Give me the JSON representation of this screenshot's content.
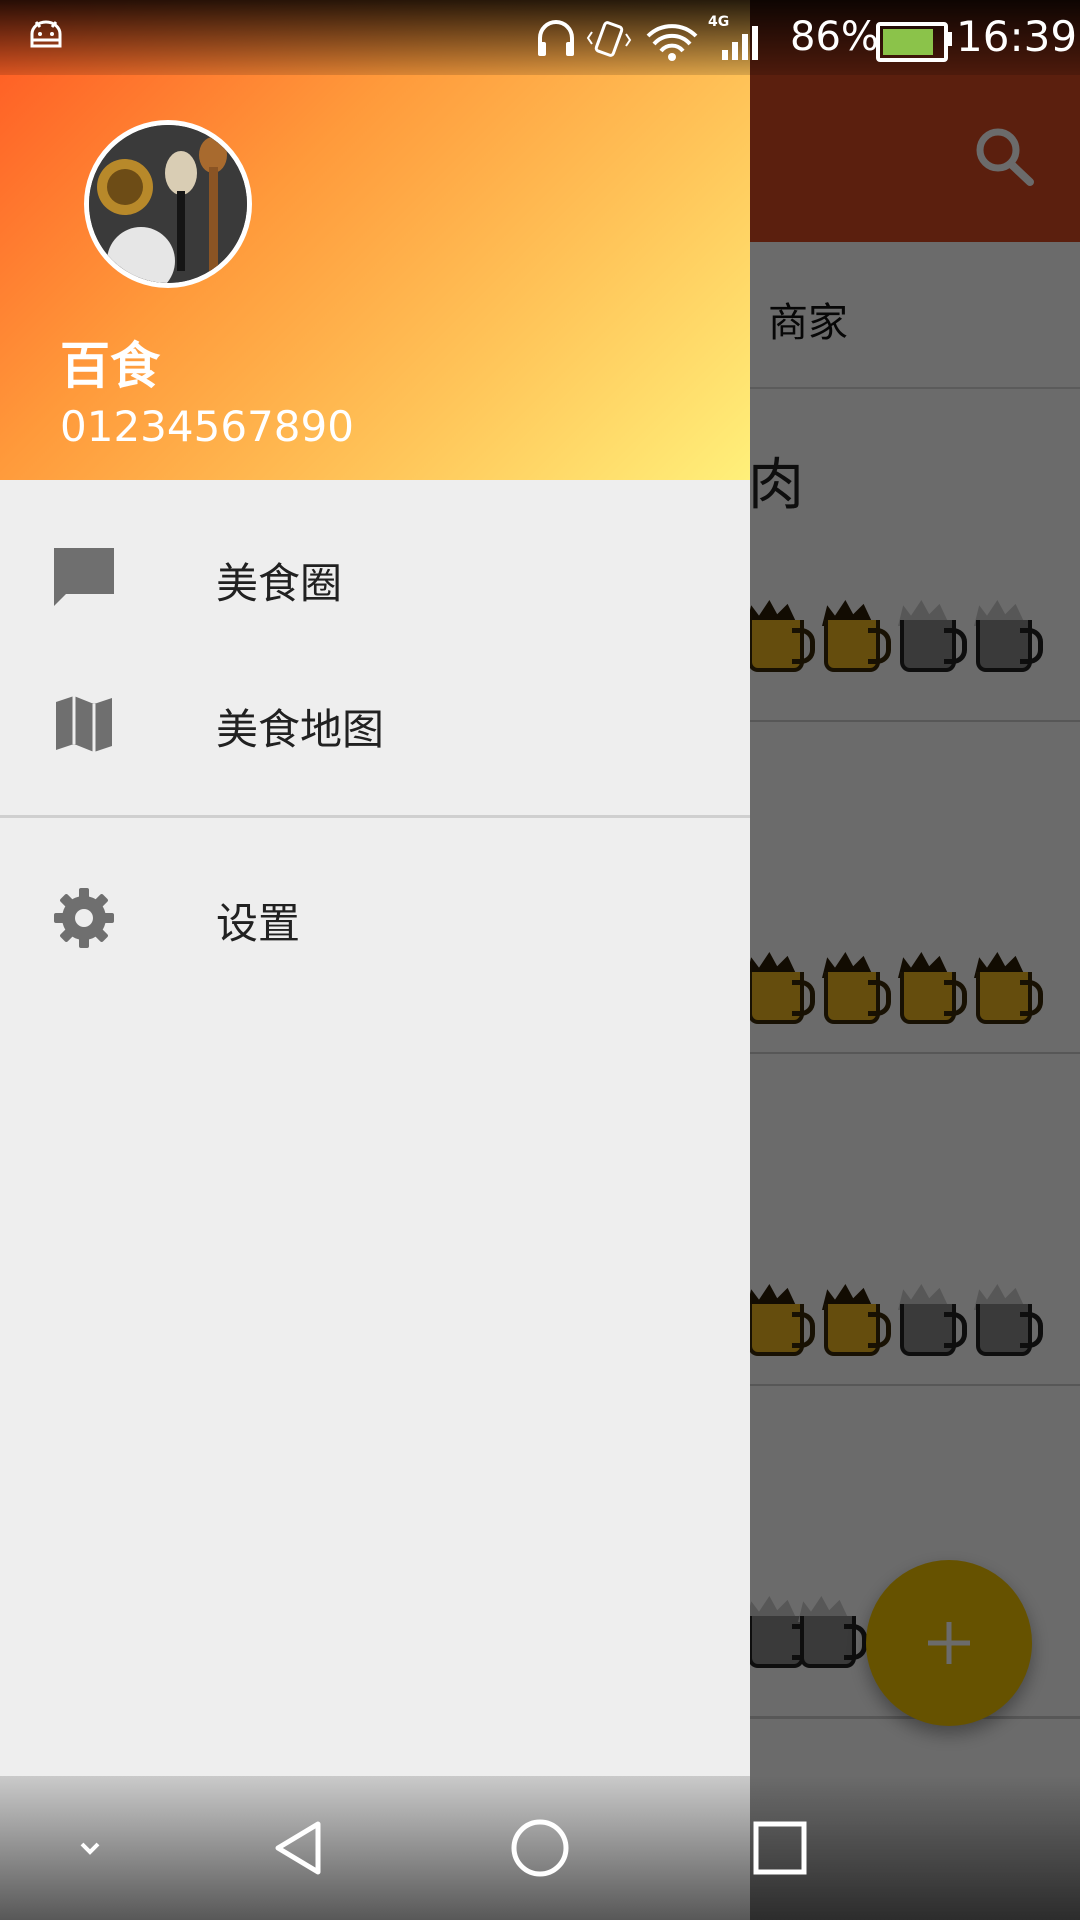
{
  "status_bar": {
    "battery_percent": "86%",
    "battery_level": 0.86,
    "time": "16:39",
    "network_label": "4G",
    "icons": [
      "android-icon",
      "headphones-icon",
      "vibrate-icon",
      "wifi-icon",
      "signal-icon",
      "battery-charging-icon"
    ]
  },
  "background_app": {
    "toolbar_color": "#d94a22",
    "search_icon": "search-icon",
    "tab_label": "商家",
    "cards": [
      {
        "title": "肉",
        "rating": 2,
        "max_rating": 4
      },
      {
        "title": "",
        "rating": 4,
        "max_rating": 4
      },
      {
        "title": "",
        "rating": 2,
        "max_rating": 4
      },
      {
        "title": "",
        "rating": 0,
        "max_rating": 2
      }
    ],
    "fab": {
      "icon": "plus-icon",
      "color": "#f2c400"
    }
  },
  "drawer": {
    "header": {
      "name": "百食",
      "phone": "01234567890",
      "gradient_colors": [
        "#ff5722",
        "#ffc65a",
        "#fff07a"
      ]
    },
    "menu": [
      {
        "label": "美食圈",
        "icon": "chat-icon"
      },
      {
        "label": "美食地图",
        "icon": "map-icon"
      }
    ],
    "settings_label": "设置",
    "settings_icon": "gear-icon"
  },
  "nav_bar": {
    "buttons": [
      "chevron-down-icon",
      "back-icon",
      "home-icon",
      "recents-icon"
    ]
  }
}
